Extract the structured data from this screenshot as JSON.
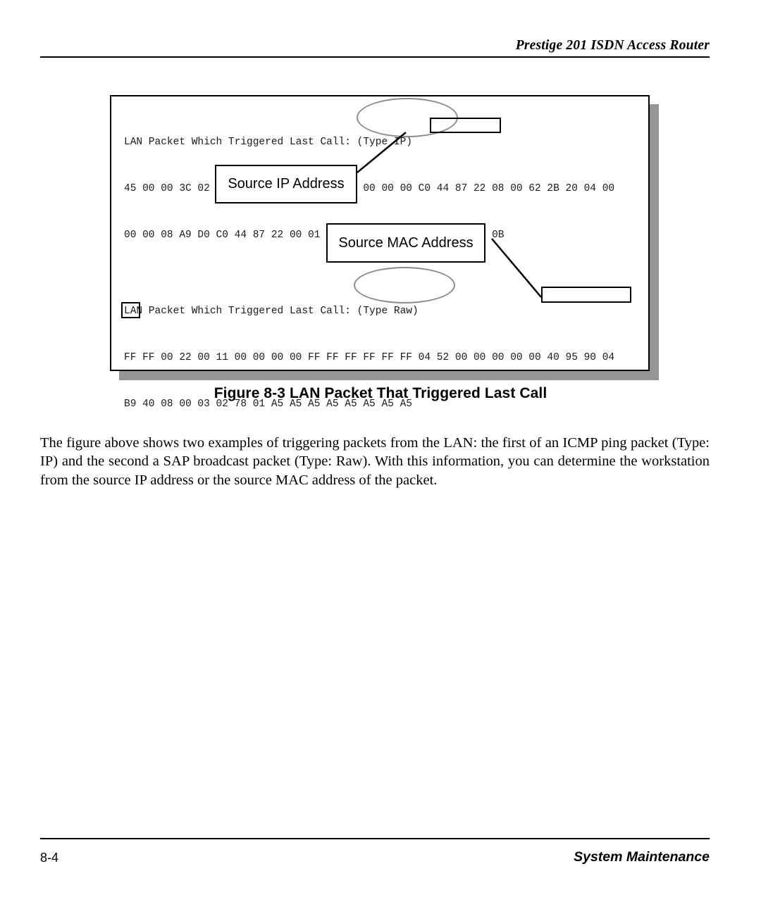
{
  "header": {
    "title": "Prestige 201 ISDN Access Router"
  },
  "figure": {
    "caption": "Figure 8-3 LAN Packet That Triggered Last Call",
    "packet1": {
      "title_line": "LAN Packet Which Triggered Last Call: (Type IP)",
      "hex_lines": [
        "45 00 00 3C 02 12 00 00 3B 01 36 49 00 00 00 00 C0 44 87 22 08 00 62 2B 20 04 00",
        "00 00 08 A9 D0 C0 44 87 22 00 01 02 03 04 05 06 07 08 09 0A 0B"
      ],
      "type_label": "(Type IP)"
    },
    "packet2": {
      "title_line": "LAN Packet Which Triggered Last Call: (Type Raw)",
      "hex_lines": [
        "FF FF 00 22 00 11 00 00 00 00 FF FF FF FF FF FF 04 52 00 00 00 00 00 40 95 90 04",
        "B9 40 08 00 03 02 78 01 A5 A5 A5 A5 A5 A5 A5 A5"
      ],
      "type_label": "(Type Raw)"
    },
    "callouts": {
      "source_ip": "Source IP Address",
      "source_mac": "Source MAC Address"
    },
    "highlights": {
      "source_ip_bytes": "C0 44 87 22",
      "source_mac_bytes": "00 40 95 90 04",
      "source_mac_tail_byte": "B9"
    },
    "colors": {
      "frame_border": "#000000",
      "shadow": "#969696",
      "ellipse_stroke": "#8c8c8c",
      "leader_stroke": "#000000"
    }
  },
  "body": {
    "paragraph": "The figure above shows two examples of triggering packets from the LAN: the first of an ICMP ping packet (Type: IP) and the second a SAP broadcast packet (Type: Raw). With this information, you can determine the workstation from the source IP address or the source MAC address of the packet."
  },
  "footer": {
    "page_number": "8-4",
    "section_title": "System Maintenance"
  }
}
